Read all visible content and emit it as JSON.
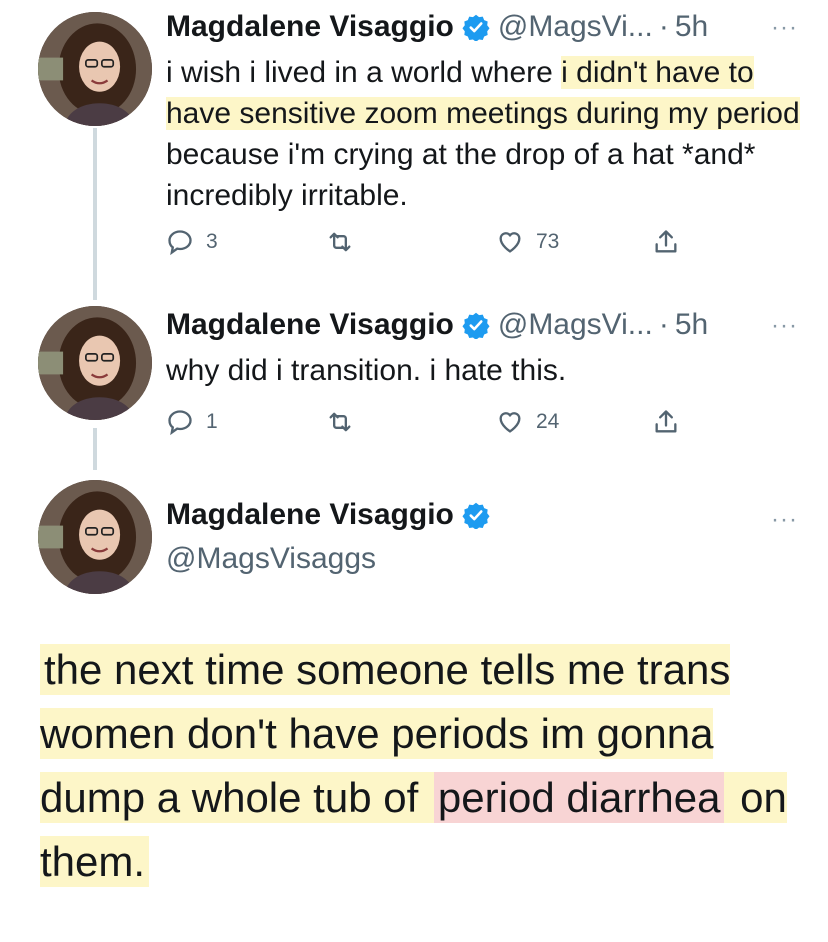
{
  "tweets": [
    {
      "name": "Magdalene Visaggio",
      "handle": "@MagsVi...",
      "separator": "·",
      "time": "5h",
      "more": "···",
      "text_plain1": "i wish i lived in a world where ",
      "text_hl1": "i didn't have to have sensitive zoom meetings during my period",
      "text_plain2": " because i'm crying at the drop of a hat *and* incredibly irritable.",
      "replies": "3",
      "retweets": "",
      "likes": "73"
    },
    {
      "name": "Magdalene Visaggio",
      "handle": "@MagsVi...",
      "separator": "·",
      "time": "5h",
      "more": "···",
      "text": "why did i transition. i hate this.",
      "replies": "1",
      "retweets": "",
      "likes": "24"
    }
  ],
  "main_tweet": {
    "name": "Magdalene Visaggio",
    "handle": "@MagsVisaggs",
    "more": "···",
    "text_hl1": "the next time someone tells me trans women don't have periods im gonna dump a whole tub of ",
    "text_hl2": "period diarrhea",
    "text_hl3": " on them."
  },
  "colors": {
    "verified": "#1d9bf0",
    "highlight_yellow": "#fdf6c8",
    "highlight_pink": "#f8d4d4"
  },
  "icons": [
    "reply-icon",
    "retweet-icon",
    "like-icon",
    "share-icon",
    "verified-badge-icon",
    "more-icon"
  ]
}
